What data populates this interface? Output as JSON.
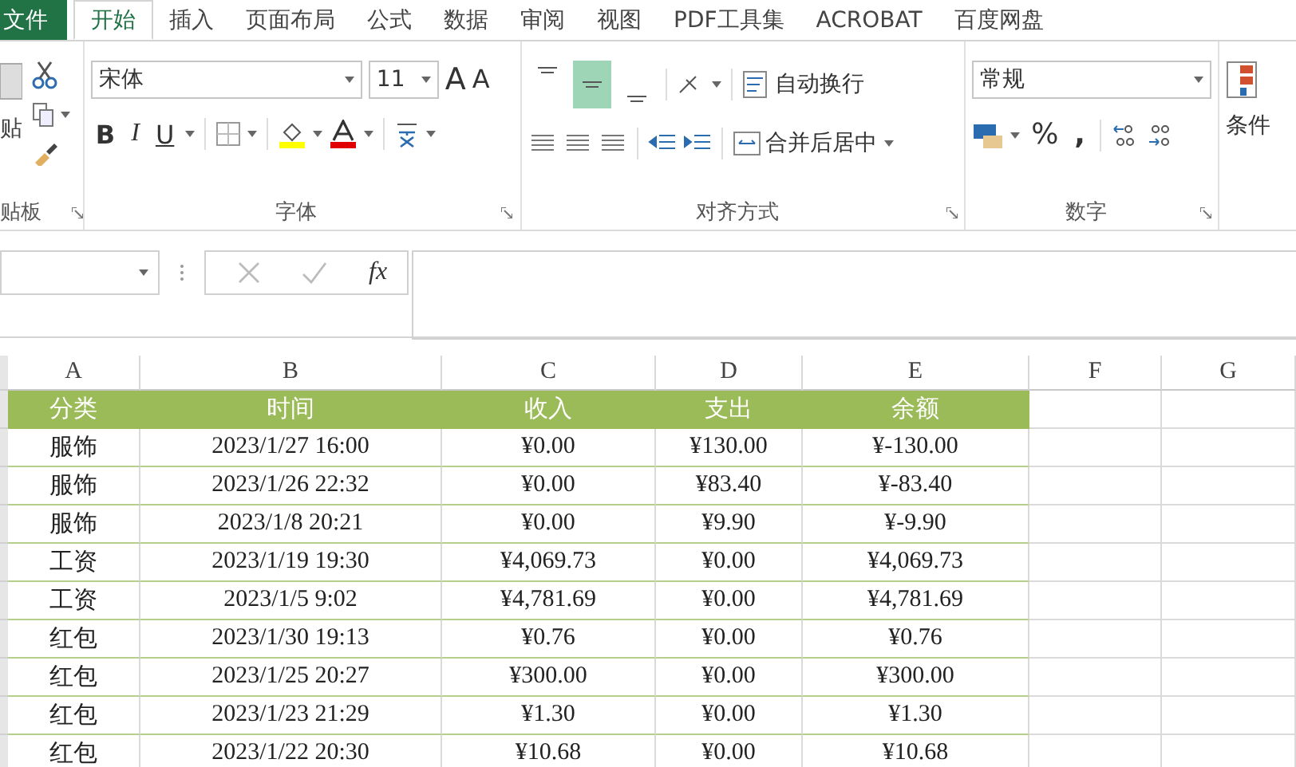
{
  "ribbon_tabs": [
    {
      "label": "文件",
      "kind": "file",
      "selected": false
    },
    {
      "label": "开始",
      "kind": "tab",
      "selected": true
    },
    {
      "label": "插入",
      "kind": "tab",
      "selected": false
    },
    {
      "label": "页面布局",
      "kind": "tab",
      "selected": false
    },
    {
      "label": "公式",
      "kind": "tab",
      "selected": false
    },
    {
      "label": "数据",
      "kind": "tab",
      "selected": false
    },
    {
      "label": "审阅",
      "kind": "tab",
      "selected": false
    },
    {
      "label": "视图",
      "kind": "tab",
      "selected": false
    },
    {
      "label": "PDF工具集",
      "kind": "tab",
      "selected": false
    },
    {
      "label": "ACROBAT",
      "kind": "tab",
      "selected": false
    },
    {
      "label": "百度网盘",
      "kind": "tab",
      "selected": false
    }
  ],
  "clipboard": {
    "paste_label": "贴",
    "group_label": "贴板"
  },
  "font": {
    "name": "宋体",
    "size": "11",
    "grow": "A",
    "shrink": "A",
    "bold": "B",
    "italic": "I",
    "underline": "U",
    "group_label": "字体"
  },
  "alignment": {
    "vertical_align": [
      {
        "selected": false
      },
      {
        "selected": true
      },
      {
        "selected": false
      }
    ],
    "wrap_text": "自动换行",
    "merge_center": "合并后居中",
    "group_label": "对齐方式"
  },
  "number": {
    "format": "常规",
    "percent": "%",
    "comma": ",",
    "group_label": "数字"
  },
  "styles": {
    "conditional_format": "条件"
  },
  "formula_bar": {
    "fx": "fx"
  },
  "sheet": {
    "columns": [
      "A",
      "B",
      "C",
      "D",
      "E",
      "F",
      "G"
    ],
    "header": [
      "分类",
      "时间",
      "收入",
      "支出",
      "余额"
    ],
    "rows": [
      [
        "服饰",
        "2023/1/27 16:00",
        "¥0.00",
        "¥130.00",
        "¥-130.00"
      ],
      [
        "服饰",
        "2023/1/26 22:32",
        "¥0.00",
        "¥83.40",
        "¥-83.40"
      ],
      [
        "服饰",
        "2023/1/8 20:21",
        "¥0.00",
        "¥9.90",
        "¥-9.90"
      ],
      [
        "工资",
        "2023/1/19 19:30",
        "¥4,069.73",
        "¥0.00",
        "¥4,069.73"
      ],
      [
        "工资",
        "2023/1/5 9:02",
        "¥4,781.69",
        "¥0.00",
        "¥4,781.69"
      ],
      [
        "红包",
        "2023/1/30 19:13",
        "¥0.76",
        "¥0.00",
        "¥0.76"
      ],
      [
        "红包",
        "2023/1/25 20:27",
        "¥300.00",
        "¥0.00",
        "¥300.00"
      ],
      [
        "红包",
        "2023/1/23 21:29",
        "¥1.30",
        "¥0.00",
        "¥1.30"
      ],
      [
        "红包",
        "2023/1/22 20:30",
        "¥10.68",
        "¥0.00",
        "¥10.68"
      ]
    ]
  }
}
